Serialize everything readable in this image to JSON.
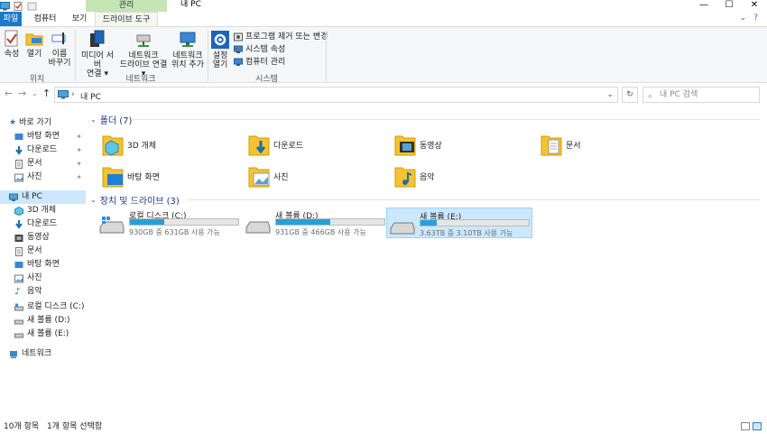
{
  "titlebar": {
    "manage_tab": "관리",
    "window_title": "내 PC",
    "minimize": "—",
    "maximize": "☐",
    "close": "✕"
  },
  "tabs": {
    "file": "파일",
    "computer": "컴퓨터",
    "view": "보기",
    "drive_tools": "드라이브 도구"
  },
  "ribbon": {
    "properties": "속성",
    "open": "열기",
    "rename_line1": "이름",
    "rename_line2": "바꾸기",
    "group_location": "위치",
    "media_line1": "미디어 서버",
    "media_line2": "연결",
    "map_drive_line1": "네트워크",
    "map_drive_line2": "드라이브 연결",
    "add_location_line1": "네트워크",
    "add_location_line2": "위치 추가",
    "group_network": "네트워크",
    "settings_line1": "설정",
    "settings_line2": "열기",
    "uninstall": "프로그램 제거 또는 변경",
    "system_props": "시스템 속성",
    "manage": "컴퓨터 관리",
    "group_system": "시스템"
  },
  "address": {
    "path": "내 PC",
    "search_placeholder": "내 PC 검색"
  },
  "nav": {
    "quick_access": "바로 가기",
    "qa_items": [
      "바탕 화면",
      "다운로드",
      "문서",
      "사진"
    ],
    "this_pc": "내 PC",
    "pc_items": [
      "3D 개체",
      "다운로드",
      "동영상",
      "문서",
      "바탕 화면",
      "사진",
      "음악",
      "로컬 디스크 (C:)",
      "새 볼륨 (D:)",
      "새 볼륨 (E:)"
    ],
    "network": "네트워크"
  },
  "content": {
    "folders_header": "폴더 (7)",
    "folders": [
      "3D 개체",
      "다운로드",
      "동영상",
      "문서",
      "바탕 화면",
      "사진",
      "음악"
    ],
    "drives_header": "장치 및 드라이브 (3)",
    "drives": [
      {
        "name": "로컬 디스크 (C:)",
        "info": "930GB 중 631GB 사용 가능",
        "used_fraction": 0.32
      },
      {
        "name": "새 볼륨 (D:)",
        "info": "931GB 중 466GB 사용 가능",
        "used_fraction": 0.5
      },
      {
        "name": "새 볼륨 (E:)",
        "info": "3.63TB 중 3.10TB 사용 가능",
        "used_fraction": 0.15
      }
    ]
  },
  "status": {
    "count": "10개 항목",
    "selected": "1개 항목 선택함"
  },
  "colors": {
    "accent": "#1979ca",
    "selection": "#cce8ff",
    "bar": "#26a0da",
    "manage_tab": "#c4e5b4",
    "section": "#1e3287"
  }
}
